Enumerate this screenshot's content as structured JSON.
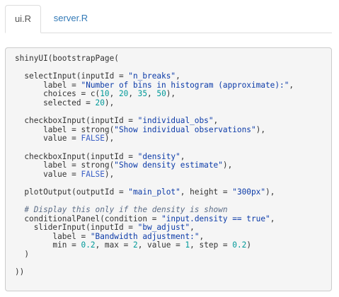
{
  "tabs": [
    {
      "label": "ui.R",
      "active": true
    },
    {
      "label": "server.R",
      "active": false
    }
  ],
  "colors": {
    "string": "#0b3aa8",
    "number": "#009999",
    "constant": "#3b60c6",
    "comment": "#5c6d87",
    "link": "#337ab7",
    "code_background": "#f5f5f5"
  },
  "code_lines": [
    [
      {
        "t": "shinyUI(bootstrapPage("
      }
    ],
    [],
    [
      {
        "t": "  selectInput(inputId = "
      },
      {
        "t": "\"n_breaks\"",
        "c": "str"
      },
      {
        "t": ","
      }
    ],
    [
      {
        "t": "      label = "
      },
      {
        "t": "\"Number of bins in histogram (approximate):\"",
        "c": "str"
      },
      {
        "t": ","
      }
    ],
    [
      {
        "t": "      choices = c("
      },
      {
        "t": "10",
        "c": "num"
      },
      {
        "t": ", "
      },
      {
        "t": "20",
        "c": "num"
      },
      {
        "t": ", "
      },
      {
        "t": "35",
        "c": "num"
      },
      {
        "t": ", "
      },
      {
        "t": "50",
        "c": "num"
      },
      {
        "t": "),"
      }
    ],
    [
      {
        "t": "      selected = "
      },
      {
        "t": "20",
        "c": "num"
      },
      {
        "t": "),"
      }
    ],
    [],
    [
      {
        "t": "  checkboxInput(inputId = "
      },
      {
        "t": "\"individual_obs\"",
        "c": "str"
      },
      {
        "t": ","
      }
    ],
    [
      {
        "t": "      label = strong("
      },
      {
        "t": "\"Show individual observations\"",
        "c": "str"
      },
      {
        "t": "),"
      }
    ],
    [
      {
        "t": "      value = "
      },
      {
        "t": "FALSE",
        "c": "const"
      },
      {
        "t": "),"
      }
    ],
    [],
    [
      {
        "t": "  checkboxInput(inputId = "
      },
      {
        "t": "\"density\"",
        "c": "str"
      },
      {
        "t": ","
      }
    ],
    [
      {
        "t": "      label = strong("
      },
      {
        "t": "\"Show density estimate\"",
        "c": "str"
      },
      {
        "t": "),"
      }
    ],
    [
      {
        "t": "      value = "
      },
      {
        "t": "FALSE",
        "c": "const"
      },
      {
        "t": "),"
      }
    ],
    [],
    [
      {
        "t": "  plotOutput(outputId = "
      },
      {
        "t": "\"main_plot\"",
        "c": "str"
      },
      {
        "t": ", height = "
      },
      {
        "t": "\"300px\"",
        "c": "str"
      },
      {
        "t": "),"
      }
    ],
    [],
    [
      {
        "t": "  # Display this only if the density is shown",
        "c": "com"
      }
    ],
    [
      {
        "t": "  conditionalPanel(condition = "
      },
      {
        "t": "\"input.density == true\"",
        "c": "str"
      },
      {
        "t": ","
      }
    ],
    [
      {
        "t": "    sliderInput(inputId = "
      },
      {
        "t": "\"bw_adjust\"",
        "c": "str"
      },
      {
        "t": ","
      }
    ],
    [
      {
        "t": "        label = "
      },
      {
        "t": "\"Bandwidth adjustment:\"",
        "c": "str"
      },
      {
        "t": ","
      }
    ],
    [
      {
        "t": "        min = "
      },
      {
        "t": "0.2",
        "c": "num"
      },
      {
        "t": ", max = "
      },
      {
        "t": "2",
        "c": "num"
      },
      {
        "t": ", value = "
      },
      {
        "t": "1",
        "c": "num"
      },
      {
        "t": ", step = "
      },
      {
        "t": "0.2",
        "c": "num"
      },
      {
        "t": ")"
      }
    ],
    [
      {
        "t": "  )"
      }
    ],
    [],
    [
      {
        "t": "))"
      }
    ]
  ]
}
